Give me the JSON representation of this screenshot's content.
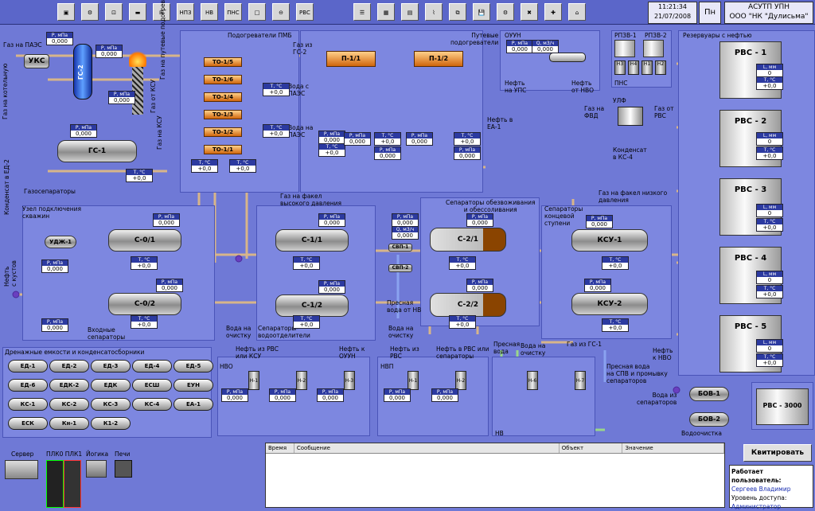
{
  "header": {
    "toolbar_left": [
      "▣",
      "⚙",
      "⊡",
      "▬",
      "⊟",
      "НПЗ",
      "НВ",
      "ПНС",
      "□",
      "⊖",
      "РВС"
    ],
    "toolbar_right": [
      "☰",
      "▦",
      "▤",
      "⌇",
      "⧉",
      "💾",
      "⚙",
      "✖",
      "✚",
      "⌂"
    ],
    "time": "11:21:34",
    "date": "21/07/2008",
    "day": "Пн",
    "system_title": "АСУТП УПН",
    "company": "ООО \"НК \"Дулисьма\""
  },
  "labels": {
    "gas_paes": "Газ на\nПАЭС",
    "uks": "УКС",
    "gs2": "ГС-2",
    "gas_boiler": "Газ на котельную",
    "gas_torch": "Газ на путевые подогреватели",
    "gas_from_ksu": "Газ от КСУ",
    "gas_to_ksu": "Газ на КСУ",
    "gs1": "ГС-1",
    "gas_separators": "Газосепараторы",
    "condensate_ee2": "Конденсат в ЕД-2",
    "pmb_title": "Подогреватели ПМБ",
    "water_paes1": "Вода с\nПАЭС",
    "water_paes2": "Вода на\nПАЭС",
    "to_items": [
      "ТО-1/5",
      "ТО-1/6",
      "ТО-1/4",
      "ТО-1/3",
      "ТО-1/2",
      "ТО-1/1"
    ],
    "gas_from_gs2": "Газ из\nГС-2",
    "road_heaters": "Путевые\nподогреватели",
    "p11": "П-1/1",
    "p12": "П-1/2",
    "oil_ee1": "Нефть в\nЕА-1",
    "ouun": "ОУУН",
    "oil_ups": "Нефть\nна УПС",
    "oil_nvo": "Нефть\nот НВО",
    "rpzv1": "РПЗВ-1",
    "rpzv2": "РПЗВ-2",
    "pns": "ПНС",
    "pumps_pns": [
      "Н3",
      "Н4",
      "Н1",
      "Н2"
    ],
    "ulf": "УЛФ",
    "gas_fvd": "Газ на\nФВД",
    "gas_from_rvs": "Газ от\nРВС",
    "cond_ks4": "Конденсат\nв КС-4",
    "tanks_title": "Резервуары с нефтью",
    "tanks": [
      "РВС - 1",
      "РВС - 2",
      "РВС - 3",
      "РВС - 4",
      "РВС - 5"
    ],
    "rvs3000": "РВС - 3000",
    "well_node": "Узел подключения\nскважин",
    "udj1": "УДЖ-1",
    "oil_from_wells": "Нефть\nс кустов",
    "c01": "С-0/1",
    "c02": "С-0/2",
    "inlet_sep": "Входные\nсепараторы",
    "gas_hp_flare": "Газ на факел\nвысокого давления",
    "c11": "С-1/1",
    "c12": "С-1/2",
    "sep_water": "Сепараторы-\nводоотделители",
    "water_clean1": "Вода на\nочистку",
    "svp1": "СВП-1",
    "svp2": "СВП-2",
    "fresh_nv": "Пресная\nвода от НВ",
    "water_clean2": "Вода на\nочистку",
    "dehydr": "Сепараторы обезвоживания\nи обессоливания",
    "c21": "С-2/1",
    "c22": "С-2/2",
    "gas_lp_flare": "Газ на факел низкого\nдавления",
    "final_sep": "Сепараторы\nконцевой\nступени",
    "ksu1": "КСУ-1",
    "ksu2": "КСУ-2",
    "gas_from_gs1": "Газ из ГС-1",
    "oil_nvo2": "Нефть\nк НВО",
    "drain_title": "Дренажные емкости и конденсатосборники",
    "drains": [
      "ЕД-1",
      "ЕД-2",
      "ЕД-3",
      "ЕД-4",
      "ЕД-5",
      "ЕД-6",
      "ЕДК-2",
      "ЕДК",
      "ЕСШ",
      "ЕУН",
      "КС-1",
      "КС-2",
      "КС-3",
      "КС-4",
      "ЕА-1",
      "ЕСК",
      "Кн-1",
      "К1-2"
    ],
    "oil_rvs_ksu": "Нефть из РВС\nили КСУ",
    "oil_to_ouun": "Нефть к\nОУУН",
    "nvo": "НВО",
    "pumps_nvo": [
      "Н-1",
      "Н-2",
      "Н-3"
    ],
    "oil_from_rvs": "Нефть из\nРВС",
    "oil_rvs_sep": "Нефть в РВС или\nсепараторы",
    "nvp": "НВП",
    "pumps_nvp": [
      "Н-1",
      "Н-2"
    ],
    "fresh_water": "Пресная\nвода",
    "water_clean3": "Вода на\nочистку",
    "pumps_nv": [
      "Н-6",
      "Н-7"
    ],
    "nv": "НВ",
    "fresh_spv": "Пресная вода\nна СПВ и промывку\nсепараторов",
    "water_from_sep": "Вода из\nсепараторов",
    "bov1": "БОВ-1",
    "bov2": "БОВ-2",
    "water_clean4": "Водоочистка"
  },
  "gauges": {
    "p_head": "P, мПа",
    "t_head": "T, °C",
    "l_head": "L, мм",
    "q_head": "Q, м3/ч",
    "p_zero": "0,000",
    "t_zero": "+0,0",
    "l_zero": "0"
  },
  "bottom": {
    "server": "Сервер",
    "plc": "ПЛК0 ПЛК1",
    "yokogawa": "Йогика",
    "printers": "Печи",
    "col_time": "Время",
    "col_msg": "Сообщение",
    "col_obj": "Объект",
    "col_val": "Значение",
    "ack": "Квитировать",
    "working_user": "Работает пользователь:",
    "user_name": "Сергеев Владимир",
    "access_level": "Уровень доступа:",
    "role": "Администратор"
  }
}
